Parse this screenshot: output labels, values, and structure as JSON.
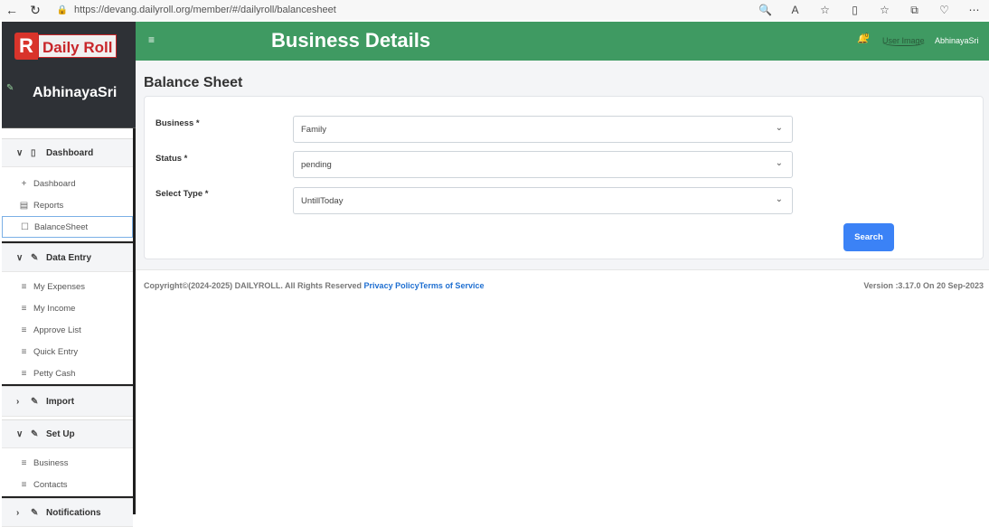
{
  "browser": {
    "url": "https://devang.dailyroll.org/member/#/dailyroll/balancesheet",
    "nav": [
      "←",
      "↻"
    ],
    "tools": [
      "🔍",
      "A",
      "☆",
      "▯",
      "☆",
      "⧉",
      "♡",
      "⋯"
    ]
  },
  "sidebar": {
    "logo_letter": "R",
    "logo_text": "Daily Roll",
    "user_name": "AbhinayaSri",
    "sections": [
      {
        "label": "Dashboard",
        "chevron": "∨",
        "icon": "▯",
        "items": [
          {
            "label": "Dashboard",
            "icon": "+"
          },
          {
            "label": "Reports",
            "icon": "▤"
          },
          {
            "label": "BalanceSheet",
            "icon": "☐"
          }
        ]
      },
      {
        "label": "Data Entry",
        "chevron": "∨",
        "icon": "✎",
        "items": [
          {
            "label": "My Expenses",
            "icon": "≡"
          },
          {
            "label": "My Income",
            "icon": "≡"
          },
          {
            "label": "Approve List",
            "icon": "≡"
          },
          {
            "label": "Quick Entry",
            "icon": "≡"
          },
          {
            "label": "Petty Cash",
            "icon": "≡"
          }
        ]
      },
      {
        "label": "Import",
        "chevron": "›",
        "icon": "✎"
      },
      {
        "label": "Set Up",
        "chevron": "∨",
        "icon": "✎",
        "items": [
          {
            "label": "Business",
            "icon": "≡"
          },
          {
            "label": "Contacts",
            "icon": "≡"
          }
        ]
      },
      {
        "label": "Notifications",
        "chevron": "›",
        "icon": "✎"
      }
    ]
  },
  "topbar": {
    "menu": "≡",
    "title": "Business Details",
    "bell": "🔔",
    "bell_count": "0",
    "user_image_alt": "User Image",
    "user_name": "AbhinayaSri",
    "color": "#3f9a62"
  },
  "main": {
    "title": "Balance Sheet",
    "form": {
      "business_label": "Business *",
      "business_value": "Family",
      "status_label": "Status *",
      "status_value": "pending",
      "type_label": "Select Type *",
      "type_value": "UntillToday",
      "dropdown": "⌄",
      "search_label": "Search"
    }
  },
  "footer": {
    "copyright": "Copyright©(2024-2025) DAILYROLL. All Rights Reserved",
    "privacy": "Privacy Policy",
    "terms": "Terms of Service",
    "version": "Version :3.17.0 On 20 Sep-2023"
  }
}
